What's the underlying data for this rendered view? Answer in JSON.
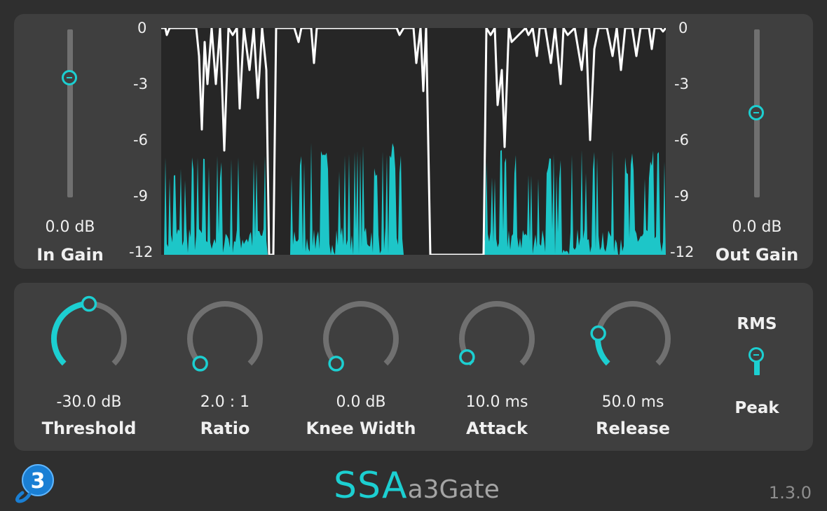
{
  "meter": {
    "scale_labels": [
      "0",
      "-3",
      "-6",
      "-9",
      "-12"
    ]
  },
  "in_gain": {
    "value": "0.0 dB",
    "label": "In Gain",
    "position": 0.3
  },
  "out_gain": {
    "value": "0.0 dB",
    "label": "Out Gain",
    "position": 0.5
  },
  "knobs": [
    {
      "name": "threshold",
      "value": "-30.0 dB",
      "label": "Threshold",
      "level": 0.5
    },
    {
      "name": "ratio",
      "value": "2.0 : 1",
      "label": "Ratio",
      "level": 0.0
    },
    {
      "name": "knee-width",
      "value": "0.0 dB",
      "label": "Knee Width",
      "level": 0.0
    },
    {
      "name": "attack",
      "value": "10.0 ms",
      "label": "Attack",
      "level": 0.05
    },
    {
      "name": "release",
      "value": "50.0 ms",
      "label": "Release",
      "level": 0.2
    }
  ],
  "detector": {
    "top_label": "RMS",
    "bottom_label": "Peak",
    "selected": "RMS"
  },
  "brand": {
    "ssa": "SSA",
    "product": "a3Gate"
  },
  "version": "1.3.0",
  "colors": {
    "accent": "#1ccfd1",
    "panel": "#3f3f3f",
    "background": "#2f2f2f",
    "track": "#707070"
  },
  "icons": {
    "logo": "b3-logo-icon"
  }
}
